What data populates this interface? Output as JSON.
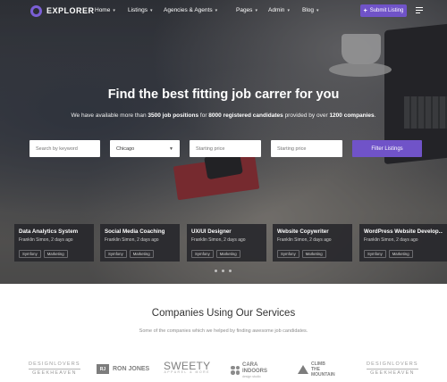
{
  "brand": {
    "name": "EXPLORER"
  },
  "nav": {
    "items": [
      {
        "label": "Home",
        "has_dropdown": true
      },
      {
        "label": "Listings",
        "has_dropdown": true
      },
      {
        "label": "Agencies & Agents",
        "has_dropdown": true
      },
      {
        "label": "Pages",
        "has_dropdown": true
      },
      {
        "label": "Admin",
        "has_dropdown": true
      },
      {
        "label": "Blog",
        "has_dropdown": true
      }
    ],
    "submit_label": "Submit Listing"
  },
  "hero": {
    "headline": "Find the best fitting job carrer for you",
    "sub_prefix": "We have available more than ",
    "sub_jobs": "3500 job positions",
    "sub_mid1": " for ",
    "sub_candidates": "8000 registered candidates",
    "sub_mid2": " provided by over ",
    "sub_companies": "1200 companies",
    "sub_suffix": "."
  },
  "search": {
    "keyword_placeholder": "Search by keyword",
    "location_value": "Chicago",
    "price_placeholder_1": "Starting price",
    "price_placeholder_2": "Starting price",
    "filter_label": "Filter Listings"
  },
  "jobs": [
    {
      "title": "Data Analytics System",
      "meta": "Franklin Simon, 2 days ago",
      "tags": [
        "Symfony",
        "Marketing"
      ]
    },
    {
      "title": "Social Media Coaching",
      "meta": "Franklin Simon, 2 days ago",
      "tags": [
        "Symfony",
        "Marketing"
      ]
    },
    {
      "title": "UX/UI Designer",
      "meta": "Franklin Simon, 2 days ago",
      "tags": [
        "Symfony",
        "Marketing"
      ]
    },
    {
      "title": "Website Copywriter",
      "meta": "Franklin Simon, 2 days ago",
      "tags": [
        "Symfony",
        "Marketing"
      ]
    },
    {
      "title": "WordPress Website Develop...",
      "meta": "Franklin Simon, 2 days ago",
      "tags": [
        "Symfony",
        "Marketing"
      ]
    }
  ],
  "companies": {
    "title": "Companies Using Our Services",
    "subtitle": "Some of the companies which we helped by finding awesome job candidates.",
    "logos": {
      "designlovers_1": {
        "top": "DESIGNLOVERS",
        "bottom": "GEEKHEAVEN"
      },
      "ronjones": {
        "mark": "RJ",
        "name": "RON JONES"
      },
      "sweety": {
        "name": "SWEETY",
        "tagline": "APPAREL & MORE"
      },
      "cara": {
        "line1": "CARA",
        "line2": "INDOORS",
        "small": "design studio"
      },
      "climb": {
        "line1": "CLIMB",
        "line2": "THE",
        "line3": "MOUNTAIN"
      },
      "designlovers_2": {
        "top": "DESIGNLOVERS",
        "bottom": "GEEKHEAVEN"
      }
    }
  },
  "colors": {
    "accent": "#7053c8",
    "card_bg": "#28282c"
  }
}
